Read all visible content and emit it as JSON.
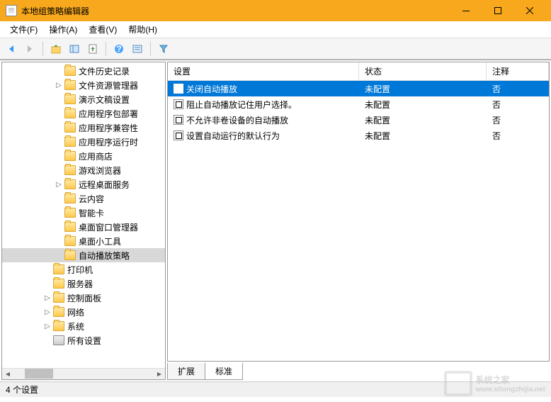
{
  "title": "本地组策略编辑器",
  "menu": {
    "file": "文件(F)",
    "action": "操作(A)",
    "view": "查看(V)",
    "help": "帮助(H)"
  },
  "tree": {
    "items": [
      {
        "label": "文件历史记录",
        "indent": 74,
        "expand": ""
      },
      {
        "label": "文件资源管理器",
        "indent": 74,
        "expand": "▷"
      },
      {
        "label": "演示文稿设置",
        "indent": 74,
        "expand": ""
      },
      {
        "label": "应用程序包部署",
        "indent": 74,
        "expand": ""
      },
      {
        "label": "应用程序兼容性",
        "indent": 74,
        "expand": ""
      },
      {
        "label": "应用程序运行时",
        "indent": 74,
        "expand": ""
      },
      {
        "label": "应用商店",
        "indent": 74,
        "expand": ""
      },
      {
        "label": "游戏浏览器",
        "indent": 74,
        "expand": ""
      },
      {
        "label": "远程桌面服务",
        "indent": 74,
        "expand": "▷"
      },
      {
        "label": "云内容",
        "indent": 74,
        "expand": ""
      },
      {
        "label": "智能卡",
        "indent": 74,
        "expand": ""
      },
      {
        "label": "桌面窗口管理器",
        "indent": 74,
        "expand": ""
      },
      {
        "label": "桌面小工具",
        "indent": 74,
        "expand": ""
      },
      {
        "label": "自动播放策略",
        "indent": 74,
        "expand": "",
        "selected": true
      },
      {
        "label": "打印机",
        "indent": 58,
        "expand": ""
      },
      {
        "label": "服务器",
        "indent": 58,
        "expand": ""
      },
      {
        "label": "控制面板",
        "indent": 58,
        "expand": "▷"
      },
      {
        "label": "网络",
        "indent": 58,
        "expand": "▷"
      },
      {
        "label": "系统",
        "indent": 58,
        "expand": "▷"
      },
      {
        "label": "所有设置",
        "indent": 58,
        "expand": "",
        "icon": "settings"
      }
    ]
  },
  "list": {
    "headers": {
      "setting": "设置",
      "status": "状态",
      "comment": "注释"
    },
    "rows": [
      {
        "setting": "关闭自动播放",
        "status": "未配置",
        "comment": "否",
        "selected": true
      },
      {
        "setting": "阻止自动播放记住用户选择。",
        "status": "未配置",
        "comment": "否"
      },
      {
        "setting": "不允许非卷设备的自动播放",
        "status": "未配置",
        "comment": "否"
      },
      {
        "setting": "设置自动运行的默认行为",
        "status": "未配置",
        "comment": "否"
      }
    ]
  },
  "tabs": {
    "extended": "扩展",
    "standard": "标准"
  },
  "status": "4 个设置",
  "watermark": {
    "text": "系统之家",
    "url": "www.xitongzhijia.net"
  }
}
